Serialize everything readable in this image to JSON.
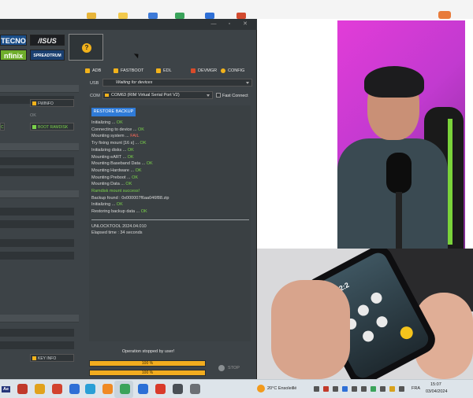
{
  "window": {
    "controls": [
      "—",
      "▫",
      "✕"
    ],
    "brands": {
      "tecno": "TECNO",
      "asus": "/ISUS",
      "infinix": "nfinix",
      "spreadtrum": "SPREADTRUM"
    },
    "help_icon": "question-icon",
    "modes": [
      {
        "label": "ADB",
        "color": "#f2b21b"
      },
      {
        "label": "FASTBOOT",
        "color": "#f2b21b"
      },
      {
        "label": "EDL",
        "color": "#f2b21b"
      },
      {
        "label": "DEVMGR",
        "color": "#d84b2a"
      },
      {
        "label": "CONFIG",
        "color": "#f2b21b"
      }
    ],
    "usb_label": "USB",
    "usb_value": "Waiting for devices",
    "com_label": "COM",
    "com_value": "COM63 (RIM Virtual Serial Port V2)",
    "fast_connect_label": "Fast Connect",
    "left_buttons": {
      "fwinfo": "FWINFO",
      "ok_label": "OK",
      "boot_ramdisk": "BOOT RAMDISK",
      "left_green": "C",
      "key_info": "KEY INFO"
    },
    "restore_button": "RESTORE BACKUP",
    "log": [
      {
        "text": "Initializing ... ",
        "status": "OK",
        "kind": "ok"
      },
      {
        "text": "Connecting to device ... ",
        "status": "OK",
        "kind": "ok"
      },
      {
        "text": "Mounting system ... ",
        "status": "FAIL",
        "kind": "fail"
      },
      {
        "text": "Try fixing mount [16 s] ... ",
        "status": "OK",
        "kind": "ok"
      },
      {
        "text": "Initializing disks ... ",
        "status": "OK",
        "kind": "ok"
      },
      {
        "text": "Mounting eART ... ",
        "status": "OK",
        "kind": "ok"
      },
      {
        "text": "Mounting Baseband Data ... ",
        "status": "OK",
        "kind": "ok"
      },
      {
        "text": "Mounting Hardware ... ",
        "status": "OK",
        "kind": "ok"
      },
      {
        "text": "Mounting Preboot ... ",
        "status": "OK",
        "kind": "ok"
      },
      {
        "text": "Mounting Data ... ",
        "status": "OK",
        "kind": "ok"
      },
      {
        "text": "Ramdisk mount success!",
        "status": "",
        "kind": "green"
      },
      {
        "text": "Backup found : 0x000007f6aa046f88.zip",
        "status": "",
        "kind": "plain"
      },
      {
        "text": "Initializing ... ",
        "status": "OK",
        "kind": "ok"
      },
      {
        "text": "Restoring backup data ... ",
        "status": "OK",
        "kind": "ok"
      }
    ],
    "footer_lines": [
      "UNLOCKTOOL 2024.04.010",
      "Elapsed time : 34 seconds"
    ],
    "status": "Operation stopped by user!",
    "progress": [
      {
        "label": "100 %",
        "percent": 100
      },
      {
        "label": "100 %",
        "percent": 100
      }
    ],
    "stop_label": "STOP"
  },
  "taskbar": {
    "search_label": "Ae",
    "weather": "20°C  Ensoleillé",
    "lang": "FRA",
    "time": "15:07",
    "date": "03/04/2024"
  }
}
